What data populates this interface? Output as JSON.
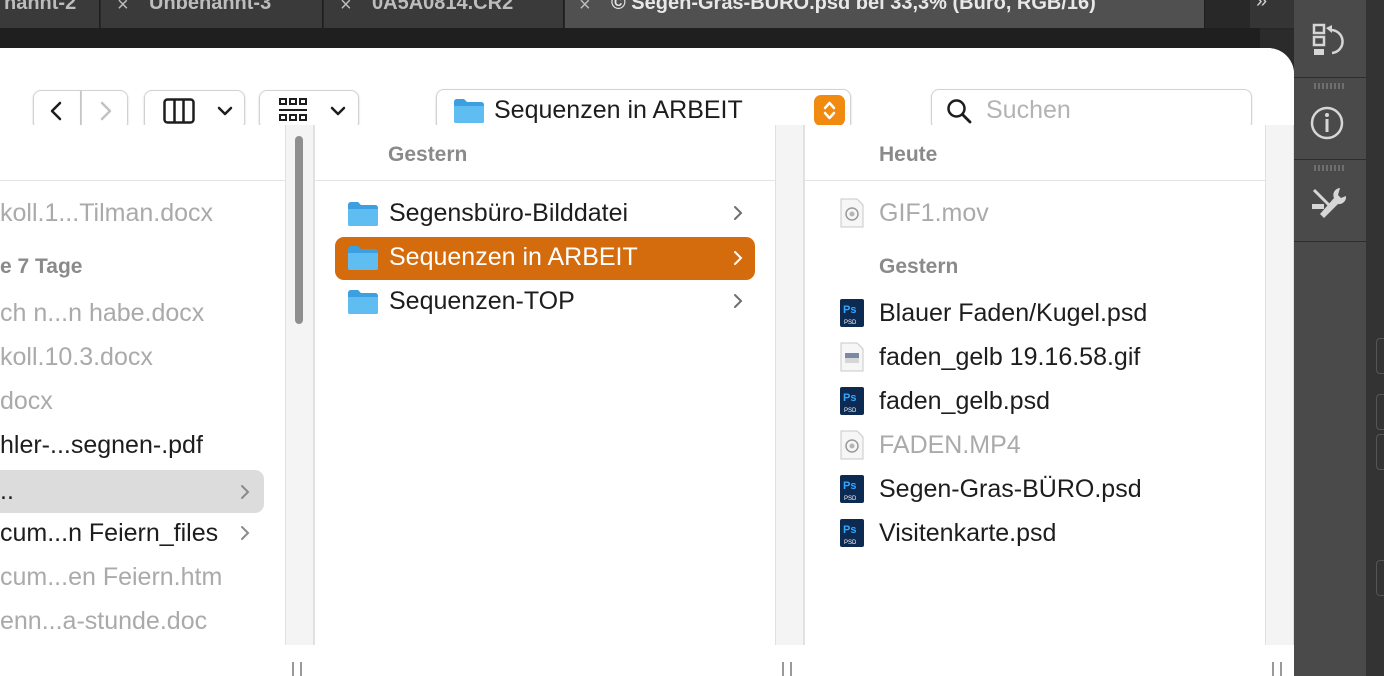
{
  "photoshop": {
    "tabs": [
      {
        "label": "nannt-2",
        "close": ""
      },
      {
        "label": "Unbenannt-3",
        "close": "×"
      },
      {
        "label": "0A5A0814.CR2",
        "close": "×"
      },
      {
        "label": "© Segen-Gras-BÜRO.psd bei 33,3% (Büro, RGB/16)",
        "close": "×"
      }
    ],
    "more": "»"
  },
  "finder": {
    "path_popup": "Sequenzen in ARBEIT",
    "search_placeholder": "Suchen",
    "column1": {
      "header_7days": "e 7 Tage",
      "items": [
        {
          "label": "koll.1...Tilman.docx",
          "dim": true,
          "chevron": false
        },
        {
          "label": "ch n...n habe.docx",
          "dim": true,
          "chevron": false
        },
        {
          "label": "koll.10.3.docx",
          "dim": true,
          "chevron": false
        },
        {
          "label": "docx",
          "dim": true,
          "chevron": false
        },
        {
          "label": "hler-...segnen-.pdf",
          "dim": false,
          "chevron": false
        },
        {
          "label": "..",
          "dim": false,
          "chevron": true
        },
        {
          "label": "cum...n Feiern_files",
          "dim": false,
          "chevron": true
        },
        {
          "label": "cum...en Feiern.htm",
          "dim": true,
          "chevron": false
        },
        {
          "label": "enn...a-stunde.doc",
          "dim": true,
          "chevron": false
        }
      ]
    },
    "column2": {
      "header": "Gestern",
      "items": [
        {
          "label": "Segensbüro-Bilddatei"
        },
        {
          "label": "Sequenzen in ARBEIT"
        },
        {
          "label": "Sequenzen-TOP"
        }
      ]
    },
    "column3": {
      "header_today": "Heute",
      "header_yesterday": "Gestern",
      "today_items": [
        {
          "label": "GIF1.mov",
          "kind": "movie",
          "dim": true
        }
      ],
      "yesterday_items": [
        {
          "label": "Blauer Faden/Kugel.psd",
          "kind": "psd",
          "dim": false
        },
        {
          "label": "faden_gelb 19.16.58.gif",
          "kind": "gif",
          "dim": false
        },
        {
          "label": "faden_gelb.psd",
          "kind": "psd",
          "dim": false
        },
        {
          "label": "FADEN.MP4",
          "kind": "movie",
          "dim": true
        },
        {
          "label": "Segen-Gras-BÜRO.psd",
          "kind": "psd",
          "dim": false
        },
        {
          "label": "Visitenkarte.psd",
          "kind": "psd",
          "dim": false
        }
      ]
    }
  },
  "colors": {
    "selection": "#d46b0c",
    "popup_stepper": "#f08a10",
    "folder": "#4fb4ee",
    "psd_icon": "#0c2a52"
  }
}
